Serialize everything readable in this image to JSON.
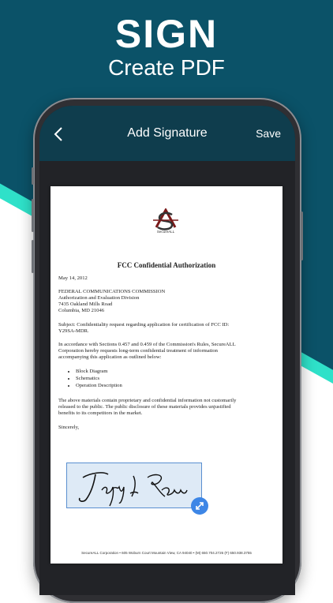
{
  "banner": {
    "headline": "SIGN",
    "subheadline": "Create PDF"
  },
  "nav": {
    "title": "Add Signature",
    "save_label": "Save"
  },
  "document": {
    "logo_text": "SecureALL",
    "title": "FCC Confidential Authorization",
    "date": "May 14, 2012",
    "address": [
      "FEDERAL COMMUNICATIONS COMMISSION",
      "Authorization and Evaluation Division",
      "7435 Oakland Mills Road",
      "Columbia, MD 21046"
    ],
    "subject": [
      "Subject: Confidentiality request regarding application for certification of FCC ID:",
      "Y29SA-MDR."
    ],
    "paragraph1": [
      "In accordance with Sections 0.457 and 0.459 of the Commission's Rules, SecureALL",
      "Corporation hereby requests long-term confidential treatment of information",
      "accompanying this application as outlined below:"
    ],
    "bullets": [
      "Block Diagram",
      "Schematics",
      "Operation Description"
    ],
    "paragraph2": [
      "The above materials contain proprietary and confidential information not customarily",
      "released to the public.  The public disclosure of these materials provides unjustified",
      "benefits to its competitors in the market."
    ],
    "closing": "Sincerely,",
    "footer": "SecureALL Corporation  • 605 Woburn Court Mountain View, CA 94040  • (M) 650.704.2726 (F) 650.938.3755"
  }
}
